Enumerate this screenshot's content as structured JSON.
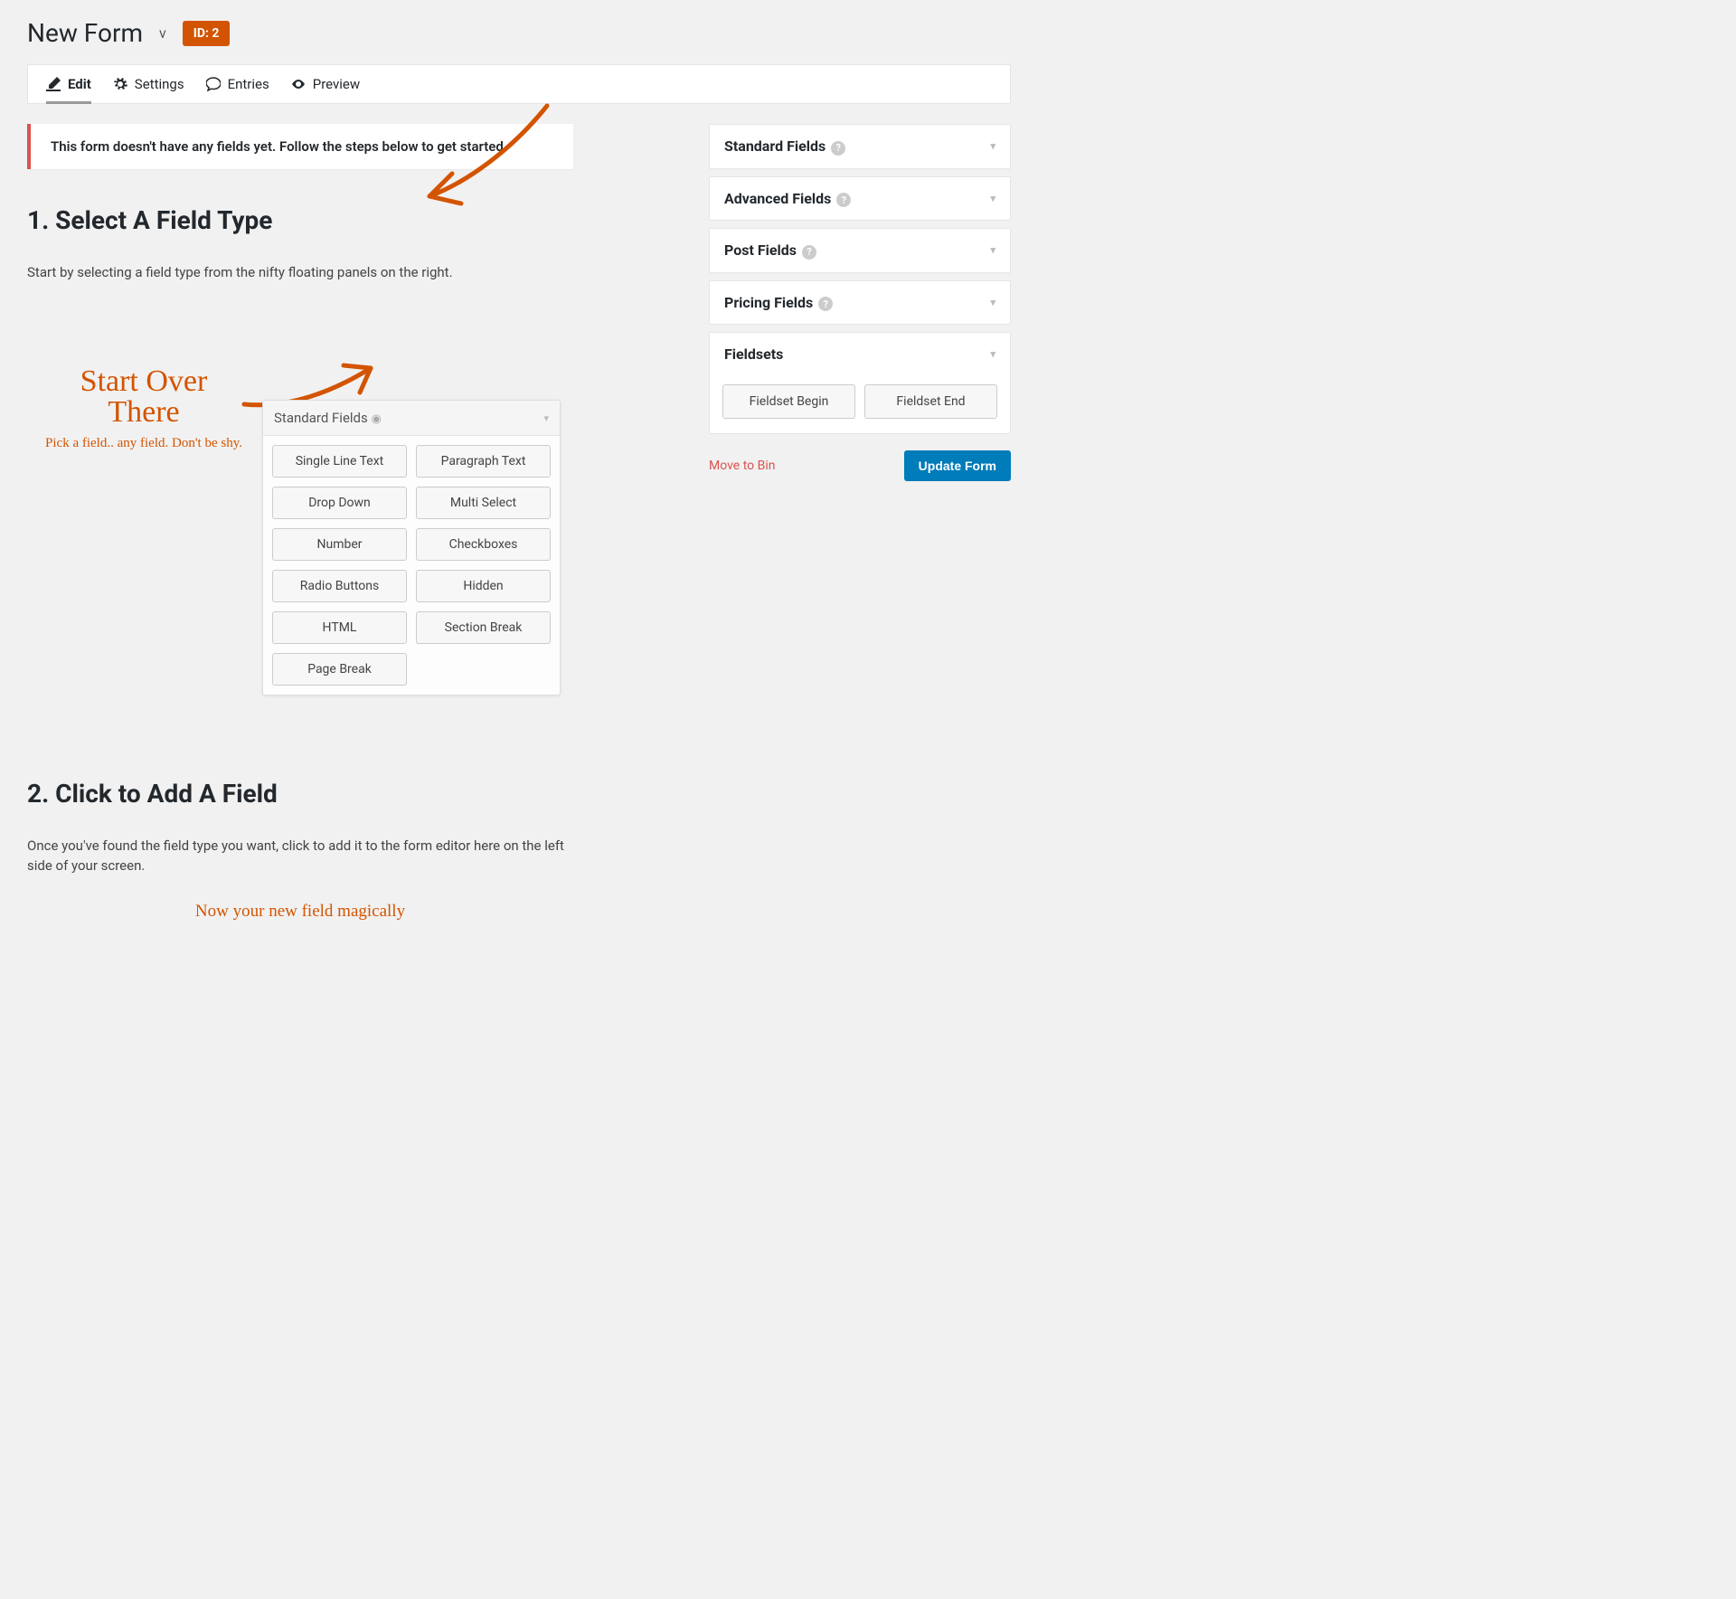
{
  "header": {
    "title": "New Form",
    "id_badge": "ID: 2"
  },
  "tabs": {
    "edit": "Edit",
    "settings": "Settings",
    "entries": "Entries",
    "preview": "Preview"
  },
  "notice": "This form doesn't have any fields yet. Follow the steps below to get started.",
  "steps": {
    "s1_title": "1. Select A Field Type",
    "s1_desc": "Start by selecting a field type from the nifty floating panels on the right.",
    "hand_big1": "Start Over",
    "hand_big2": "There",
    "hand_small": "Pick a field.. any field. Don't be shy.",
    "demo_title": "Standard Fields",
    "demo_fields": [
      "Single Line Text",
      "Paragraph Text",
      "Drop Down",
      "Multi Select",
      "Number",
      "Checkboxes",
      "Radio Buttons",
      "Hidden",
      "HTML",
      "Section Break",
      "Page Break"
    ],
    "s2_title": "2. Click to Add A Field",
    "s2_desc": "Once you've found the field type you want, click to add it to the form editor here on the left side of your screen.",
    "hand_bottom": "Now your new field magically"
  },
  "sidebar": {
    "groups": [
      "Standard Fields",
      "Advanced Fields",
      "Post Fields",
      "Pricing Fields",
      "Fieldsets"
    ],
    "fieldset_begin": "Fieldset Begin",
    "fieldset_end": "Fieldset End",
    "move_to_bin": "Move to Bin",
    "update_form": "Update Form"
  }
}
